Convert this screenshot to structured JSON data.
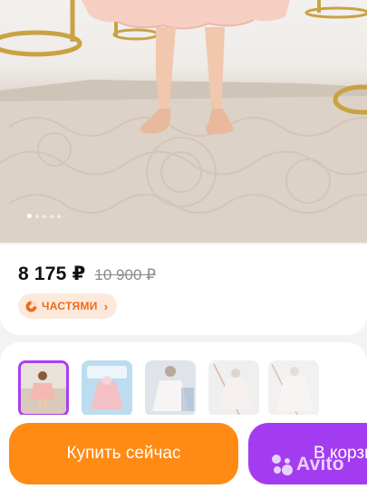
{
  "gallery": {
    "image_count": 5,
    "active_index": 0
  },
  "pricing": {
    "price": "8 175 ₽",
    "old_price": "10 900 ₽"
  },
  "installments": {
    "label": "ЧАСТЯМИ",
    "chevron": "›",
    "icon": "pie-clock-icon"
  },
  "thumbnails": [
    {
      "name": "thumb-1",
      "selected": true
    },
    {
      "name": "thumb-2",
      "selected": false
    },
    {
      "name": "thumb-3",
      "selected": false
    },
    {
      "name": "thumb-4",
      "selected": false
    },
    {
      "name": "thumb-5",
      "selected": false
    }
  ],
  "actions": {
    "buy_label": "Купить сейчас",
    "cart_label": "В корзину"
  },
  "watermark": {
    "text": "Avito"
  },
  "colors": {
    "buy": "#ff8a14",
    "cart": "#a33cf0",
    "installments": "#f06a1b",
    "thumb_selected": "#a93ef2"
  }
}
